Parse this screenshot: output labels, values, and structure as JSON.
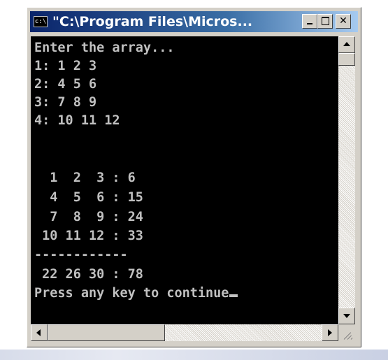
{
  "window": {
    "title": "\"C:\\Program Files\\Micros...",
    "system_icon": "console-icon",
    "minimize_label": "minimize",
    "maximize_label": "maximize",
    "close_label": "✕"
  },
  "console": {
    "lines": [
      "Enter the array...",
      "1: 1 2 3",
      "2: 4 5 6",
      "3: 7 8 9",
      "4: 10 11 12",
      "",
      "",
      "  1  2  3 : 6",
      "  4  5  6 : 15",
      "  7  8  9 : 24",
      " 10 11 12 : 33",
      "------------",
      " 22 26 30 : 78",
      "Press any key to continue"
    ]
  },
  "scrollbars": {
    "vertical_position": 0.0,
    "horizontal_position": 0.0
  }
}
